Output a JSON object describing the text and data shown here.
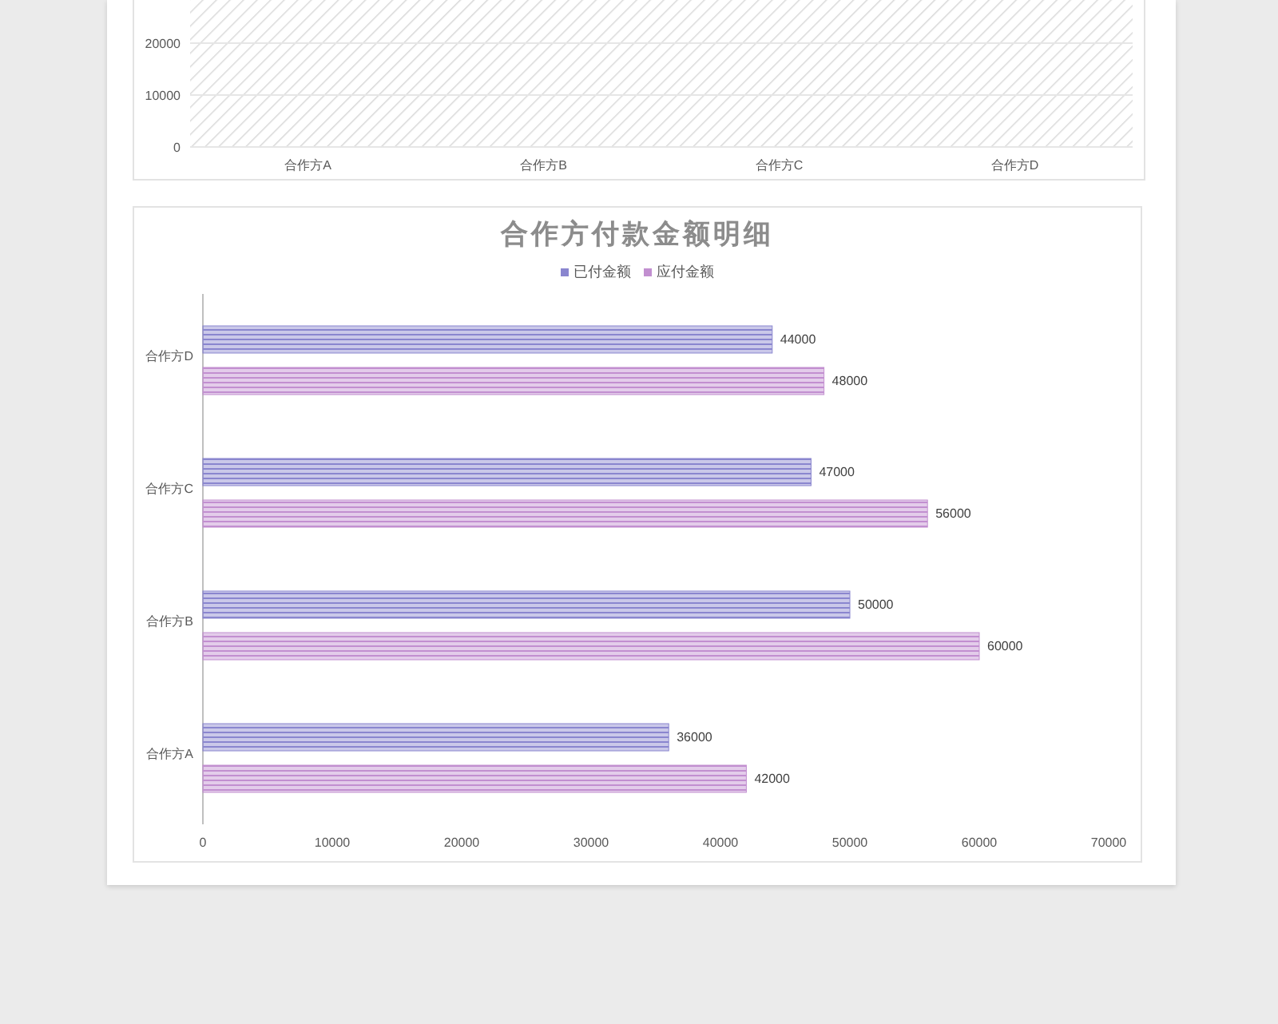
{
  "top_chart": {
    "chart_data": {
      "type": "bar",
      "categories": [
        "合作方A",
        "合作方B",
        "合作方C",
        "合作方D"
      ],
      "ylim": [
        0,
        28300
      ],
      "yticks": [
        0,
        10000,
        20000
      ]
    }
  },
  "bottom_chart": {
    "chart_data": {
      "type": "bar",
      "orientation": "horizontal",
      "title": "合作方付款金额明细",
      "categories": [
        "合作方D",
        "合作方C",
        "合作方B",
        "合作方A"
      ],
      "series": [
        {
          "name": "已付金额",
          "color": "#8a86cf",
          "values": [
            44000,
            47000,
            50000,
            36000
          ]
        },
        {
          "name": "应付金额",
          "color": "#c28fd0",
          "values": [
            48000,
            56000,
            60000,
            42000
          ]
        }
      ],
      "xlim": [
        0,
        70000
      ],
      "xticks": [
        0,
        10000,
        20000,
        30000,
        40000,
        50000,
        60000,
        70000
      ],
      "data_labels": true
    }
  }
}
